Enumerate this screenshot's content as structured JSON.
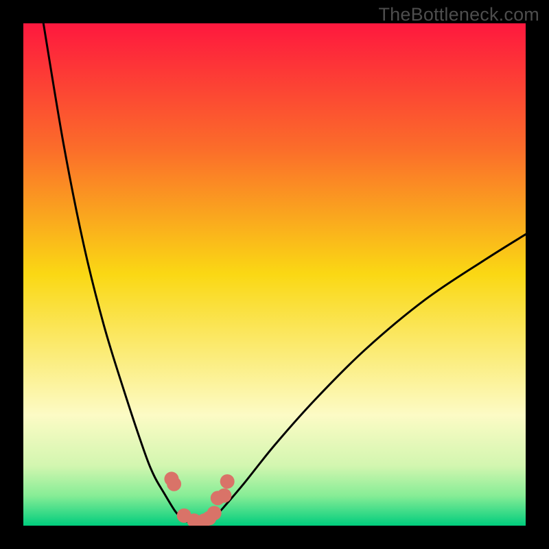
{
  "watermark": "TheBottleneck.com",
  "colors": {
    "frame": "#000000",
    "curve": "#000000",
    "points": "#d97368",
    "band_top": "#02ce7e",
    "band_near": "#9df29e",
    "band_wide": "#fdfcc7"
  },
  "chart_data": {
    "type": "line",
    "title": "",
    "xlabel": "",
    "ylabel": "",
    "xlim": [
      0,
      100
    ],
    "ylim": [
      0,
      100
    ],
    "grid": false,
    "series": [
      {
        "name": "left-branch",
        "x": [
          4,
          8,
          12,
          16,
          20,
          24,
          26,
          28,
          30,
          31,
          32,
          33,
          34,
          35
        ],
        "y": [
          100,
          76,
          56,
          40,
          27,
          15,
          10,
          6.5,
          3.2,
          2.0,
          1.2,
          0.6,
          0.2,
          0.05
        ]
      },
      {
        "name": "right-branch",
        "x": [
          35,
          36,
          37,
          38,
          40,
          44,
          50,
          58,
          68,
          80,
          92,
          100
        ],
        "y": [
          0.05,
          0.2,
          0.8,
          1.6,
          3.8,
          8.5,
          16,
          25,
          35,
          45,
          53,
          58
        ]
      }
    ],
    "scatter": {
      "name": "highlight-points",
      "x": [
        29.5,
        30.0,
        32.0,
        34.0,
        36.0,
        37.0,
        38.0,
        38.7,
        40.0,
        40.6
      ],
      "y": [
        9.3,
        8.3,
        2.0,
        1.0,
        1.0,
        1.5,
        2.5,
        5.5,
        6.0,
        8.8
      ]
    },
    "gradient_stops": [
      {
        "pct": 0,
        "color": "#fe183e"
      },
      {
        "pct": 25,
        "color": "#fb6d2a"
      },
      {
        "pct": 50,
        "color": "#fad814"
      },
      {
        "pct": 78,
        "color": "#fcfbc5"
      },
      {
        "pct": 88,
        "color": "#d3f6b0"
      },
      {
        "pct": 94,
        "color": "#87ed96"
      },
      {
        "pct": 100,
        "color": "#00cd7d"
      }
    ]
  }
}
